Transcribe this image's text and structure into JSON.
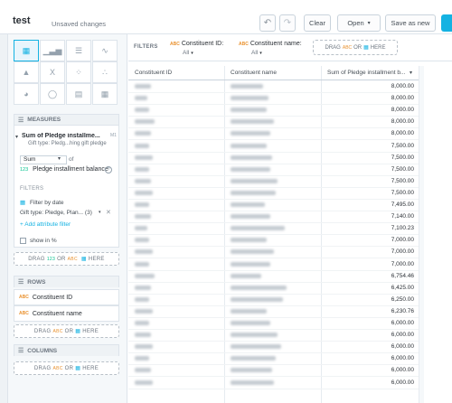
{
  "header": {
    "title": "test",
    "status": "Unsaved changes",
    "undo_icon": "undo-icon",
    "redo_icon": "redo-icon",
    "clear_label": "Clear",
    "open_label": "Open",
    "save_as_label": "Save as new"
  },
  "viz_types": [
    "table",
    "bar",
    "column",
    "line",
    "area",
    "headline",
    "scatter",
    "bubble",
    "pie",
    "donut",
    "treemap",
    "heatmap"
  ],
  "measures": {
    "section_label": "MEASURES",
    "measure_title": "Sum of Pledge installme...",
    "measure_subtitle": "Gift type: Pledg...hing gift pledge",
    "measure_id": "M1",
    "aggregation": "Sum",
    "of_label": "of",
    "attribute_badge": "123",
    "attribute": "Pledge installment balance",
    "filters_label": "FILTERS",
    "filter_date": "Filter by date",
    "filter_gift": "Gift type: Pledge, Plan...",
    "filter_gift_count": "(3)",
    "add_filter": "Add attribute filter",
    "show_pct": "show in %",
    "drop_prefix": "DRAG",
    "drop_badge_num": "123",
    "drop_or": "OR",
    "drop_badge_abc": "ABC",
    "drop_suffix": "HERE"
  },
  "rows": {
    "section_label": "ROWS",
    "items": [
      "Constituent ID",
      "Constituent name"
    ]
  },
  "columns": {
    "section_label": "COLUMNS"
  },
  "filterbar": {
    "label": "FILTERS",
    "chip1_name": "Constituent ID:",
    "chip1_value": "All",
    "chip2_name": "Constituent name:",
    "chip2_value": "All"
  },
  "table": {
    "headers": [
      "Constituent ID",
      "Constituent name",
      "Sum of Pledge installment b..."
    ],
    "values": [
      "8,000.00",
      "8,000.00",
      "8,000.00",
      "8,000.00",
      "8,000.00",
      "7,500.00",
      "7,500.00",
      "7,500.00",
      "7,500.00",
      "7,500.00",
      "7,495.00",
      "7,140.00",
      "7,100.23",
      "7,000.00",
      "7,000.00",
      "7,000.00",
      "6,754.46",
      "6,425.00",
      "6,250.00",
      "6,230.76",
      "6,000.00",
      "6,000.00",
      "6,000.00",
      "6,000.00",
      "6,000.00",
      "6,000.00"
    ]
  },
  "colors": {
    "accent": "#14b2e2",
    "numeric_badge": "#00c18d",
    "text_badge": "#e9912e"
  }
}
